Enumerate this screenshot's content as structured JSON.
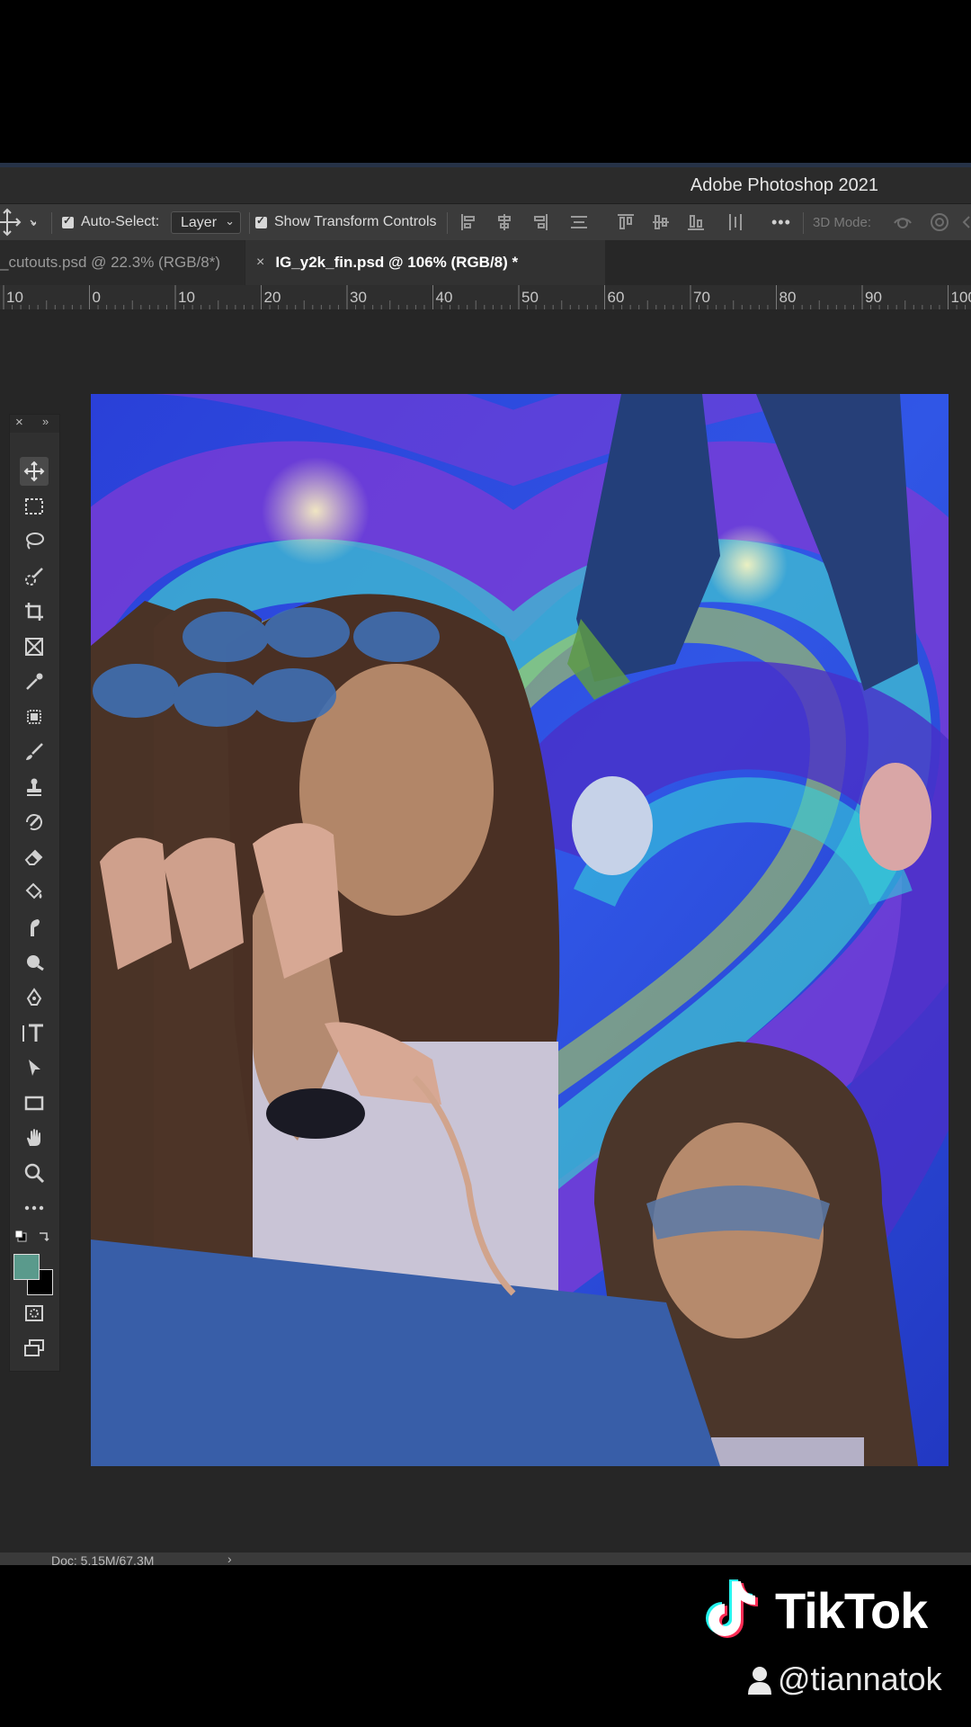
{
  "app": {
    "title": "Adobe Photoshop 2021"
  },
  "options_bar": {
    "auto_select_label": "Auto-Select:",
    "auto_select_value": "Layer",
    "auto_select_checked": true,
    "show_transform_label": "Show Transform Controls",
    "show_transform_checked": true,
    "more_label": "•••",
    "mode_3d_label": "3D Mode:"
  },
  "tabs": [
    {
      "label": "_cutouts.psd @ 22.3% (RGB/8*)",
      "active": false
    },
    {
      "label": "IG_y2k_fin.psd @ 106% (RGB/8) *",
      "active": true,
      "close": "×"
    }
  ],
  "ruler": {
    "labels": [
      "10",
      "0",
      "10",
      "20",
      "30",
      "40",
      "50",
      "60",
      "70",
      "80",
      "90",
      "100"
    ]
  },
  "toolbar": {
    "close_glyph": "×",
    "expand_glyph": "»",
    "foreground_color": "#5a9a8c",
    "background_color": "#000000",
    "tools": [
      "move-tool",
      "marquee-tool",
      "lasso-tool",
      "quick-selection-tool",
      "crop-tool",
      "frame-tool",
      "eyedropper-tool",
      "healing-brush-tool",
      "brush-tool",
      "clone-stamp-tool",
      "history-brush-tool",
      "eraser-tool",
      "paint-bucket-tool",
      "smudge-tool",
      "dodge-tool",
      "pen-tool",
      "type-tool",
      "path-selection-tool",
      "rectangle-tool",
      "hand-tool",
      "zoom-tool",
      "more-tools",
      "swap-colors",
      "quick-mask-mode",
      "screen-mode"
    ]
  },
  "statusbar": {
    "doc_info": "Doc: 5.15M/67.3M",
    "arrow": "›"
  },
  "watermark": {
    "brand": "TikTok",
    "handle": "@tiannatok"
  }
}
